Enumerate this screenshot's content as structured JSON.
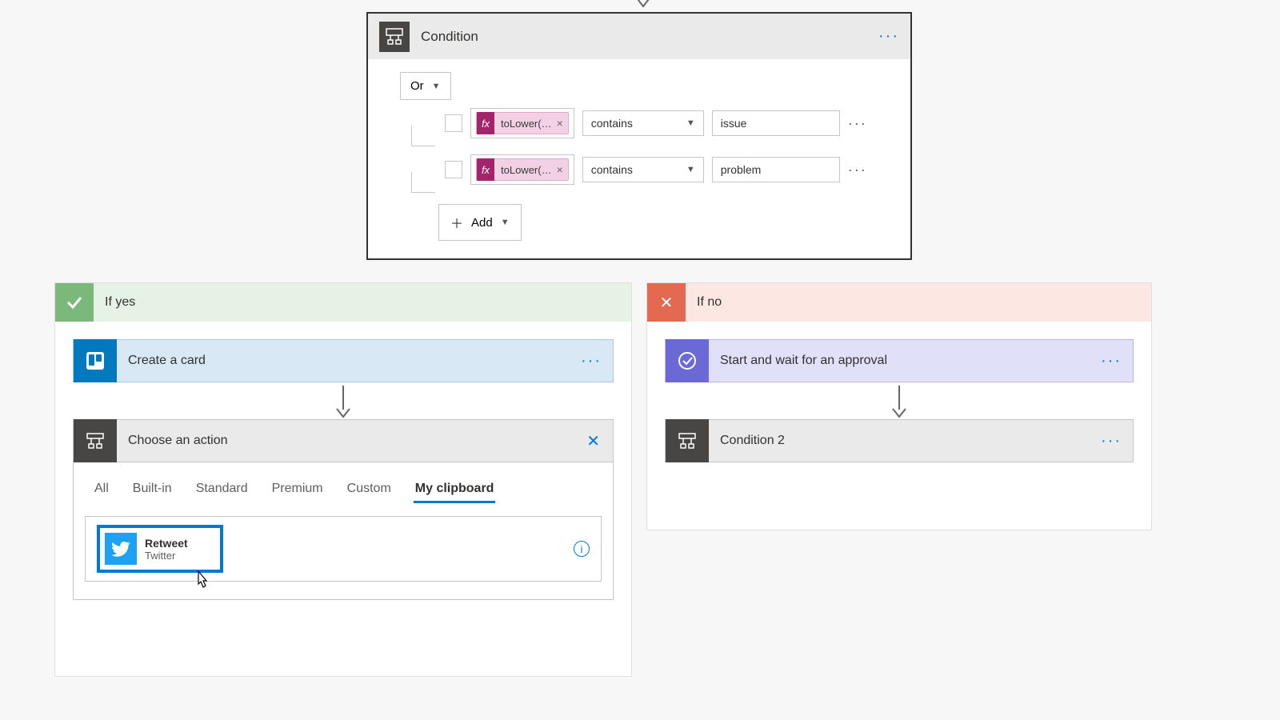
{
  "condition": {
    "title": "Condition",
    "logic": "Or",
    "rows": [
      {
        "token": "toLower(…",
        "op": "contains",
        "value": "issue"
      },
      {
        "token": "toLower(…",
        "op": "contains",
        "value": "problem"
      }
    ],
    "add": "Add",
    "fx": "fx"
  },
  "branches": {
    "yes": {
      "label": "If yes",
      "create_card": "Create a card",
      "choose_action": "Choose an action",
      "tabs": [
        "All",
        "Built-in",
        "Standard",
        "Premium",
        "Custom",
        "My clipboard"
      ],
      "active_tab": "My clipboard",
      "clipboard_item": {
        "title": "Retweet",
        "subtitle": "Twitter"
      }
    },
    "no": {
      "label": "If no",
      "approval": "Start and wait for an approval",
      "cond2": "Condition 2"
    }
  }
}
